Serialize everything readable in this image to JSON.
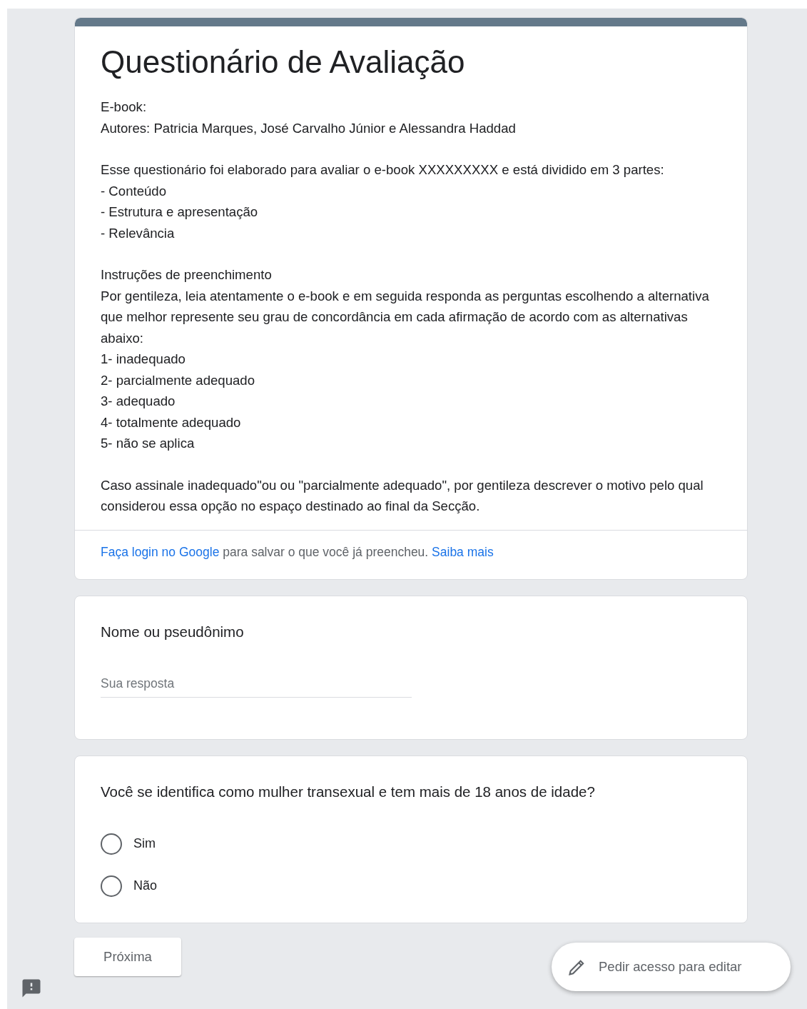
{
  "form": {
    "title": "Questionário de Avaliação",
    "description": [
      "E-book:\nAutores: Patricia Marques, José Carvalho Júnior e Alessandra Haddad",
      "Esse questionário foi elaborado para avaliar o e-book XXXXXXXXX e está dividido em 3 partes:\n- Conteúdo\n- Estrutura e apresentação\n- Relevância",
      "Instruções de preenchimento\nPor gentileza, leia atentamente o e-book e em seguida responda as perguntas escolhendo a alternativa que melhor represente seu grau de concordância em cada afirmação de acordo com as alternativas abaixo:\n1- inadequado\n2- parcialmente adequado\n3- adequado\n4- totalmente adequado\n5- não se aplica",
      "Caso assinale inadequado\"ou ou \"parcialmente adequado\", por gentileza descrever o motivo pelo qual considerou essa opção no espaço destinado ao final da Secção."
    ],
    "login_notice": {
      "link": "Faça login no Google",
      "text": "para salvar o que você já preencheu.",
      "more_link": "Saiba mais"
    }
  },
  "questions": [
    {
      "kind": "text",
      "title": "Nome ou pseudônimo",
      "placeholder": "Sua resposta"
    },
    {
      "kind": "radio",
      "title": "Você se identifica como mulher transexual e tem mais de 18 anos de idade?",
      "options": [
        {
          "label": "Sim",
          "selected": false
        },
        {
          "label": "Não",
          "selected": false
        }
      ]
    }
  ],
  "next_button": "Próxima",
  "edit_access_button": "Pedir acesso para editar"
}
